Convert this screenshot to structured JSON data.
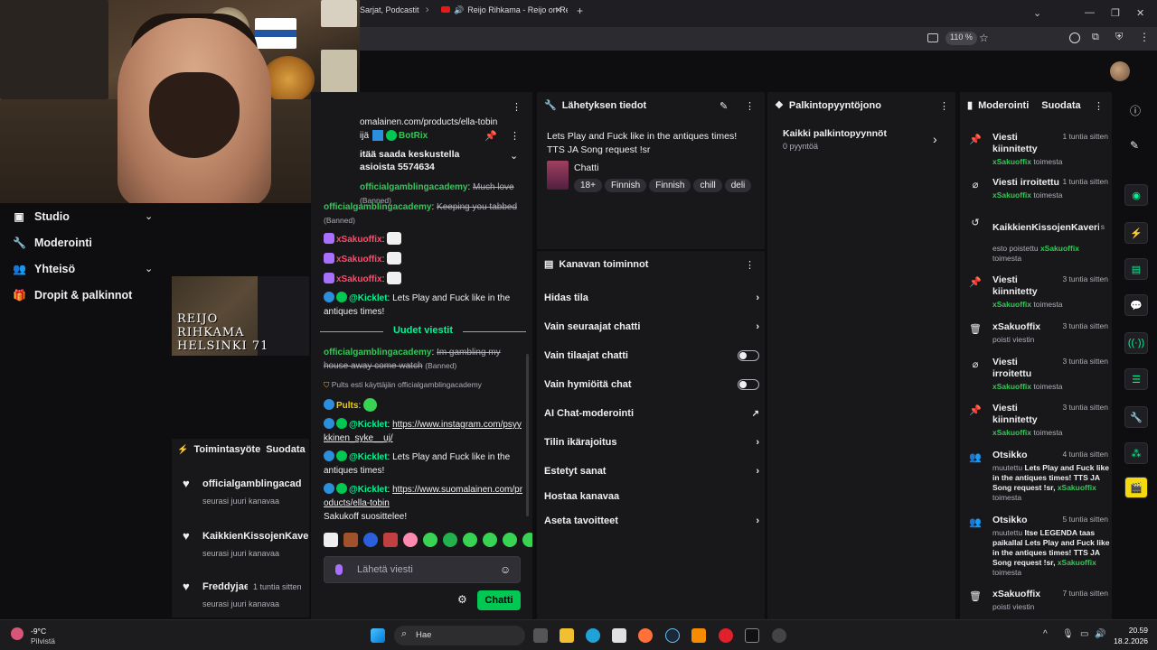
{
  "browser": {
    "tabs": [
      {
        "label": "Sarjat, Podcastit, Su"
      },
      {
        "label": "Reijo Rihkama - Reijo on Re"
      }
    ],
    "zoom": "110 %"
  },
  "nav": {
    "items": [
      {
        "label": "Studio",
        "icon": "camera-icon"
      },
      {
        "label": "Moderointi",
        "icon": "wrench-icon"
      },
      {
        "label": "Yhteisö",
        "icon": "people-icon"
      },
      {
        "label": "Dropit & palkinnot",
        "icon": "gift-icon"
      }
    ]
  },
  "preview": {
    "overlay_text": "REIJO RIHKAMA HELSINKI 71"
  },
  "activity": {
    "title": "Toimintasyöte",
    "filter": "Suodata",
    "items": [
      {
        "user": "officialgamblingacad",
        "time": "",
        "text": "seurasi juuri kanavaa"
      },
      {
        "user": "KaikkienKissojenKave",
        "time": "",
        "text": "seurasi juuri kanavaa"
      },
      {
        "user": "Freddyjael",
        "time": "1 tuntia sitten",
        "text": "seurasi juuri kanavaa"
      }
    ]
  },
  "chat": {
    "pinned_link": "omalainen.com/products/ella-tobin",
    "pinned_by_prefix": "ijä",
    "pinned_user": "BotRix",
    "pinned_text": "itää saada keskustella asioista 5574634",
    "messages": [
      {
        "user": "officialgamblingacademy",
        "text": "Much love",
        "status": "(Banned)"
      },
      {
        "user": "officialgamblingacademy",
        "text": "Keeping you tabbed",
        "status": "(Banned)"
      },
      {
        "user": "xSakuoffix",
        "text": ""
      },
      {
        "user": "xSakuoffix",
        "text": ""
      },
      {
        "user": "xSakuoffix",
        "text": ""
      },
      {
        "user": "@Kicklet",
        "text": "Lets Play and Fuck like in the antiques times!"
      }
    ],
    "new_messages_label": "Uudet viestit",
    "messages_after": [
      {
        "user": "officialgamblingacademy",
        "text": "Im gambling my house away come watch",
        "status": "(Banned)"
      },
      {
        "system": "Pults esti käyttäjän officialgamblingacademy"
      },
      {
        "user": "Pults",
        "text": ""
      },
      {
        "user": "@Kicklet",
        "text": "https://www.instagram.com/psyykkinen_syke__uj/"
      },
      {
        "user": "@Kicklet",
        "text": "Lets Play and Fuck like in the antiques times!"
      },
      {
        "user": "@Kicklet",
        "text": "https://www.suomalainen.com/products/ella-tobin",
        "extra": "Sakukoff suosittelee!"
      }
    ],
    "input_placeholder": "Lähetä viesti",
    "send_label": "Chatti"
  },
  "stream_info": {
    "title": "Lähetyksen tiedot",
    "stream_title": "Lets Play and Fuck like in the antiques times! TTS JA Song request !sr",
    "category": "Chatti",
    "tags": [
      "18+",
      "Finnish",
      "Finnish",
      "chill",
      "deli"
    ]
  },
  "channel_tools": {
    "title": "Kanavan toiminnot",
    "items": [
      {
        "label": "Hidas tila",
        "control": "chevron"
      },
      {
        "label": "Vain seuraajat chatti",
        "control": "chevron"
      },
      {
        "label": "Vain tilaajat chatti",
        "control": "toggle"
      },
      {
        "label": "Vain hymiöitä chat",
        "control": "toggle"
      },
      {
        "label": "AI Chat-moderointi",
        "control": "external"
      },
      {
        "label": "Tilin ikärajoitus",
        "control": "chevron"
      },
      {
        "label": "Estetyt sanat",
        "control": "chevron"
      },
      {
        "label": "Hostaa kanavaa",
        "control": "none"
      },
      {
        "label": "Aseta tavoitteet",
        "control": "chevron"
      }
    ]
  },
  "rewards": {
    "title": "Palkintopyyntöjono",
    "item_label": "Kaikki palkintopyynnöt",
    "item_count": "0 pyyntöä"
  },
  "modlog": {
    "title": "Moderointi",
    "filter": "Suodata",
    "entries": [
      {
        "icon": "pin-icon",
        "action": "Viesti kiinnitetty",
        "time": "1 tuntia sitten",
        "mod": "xSakuoffix",
        "suffix": "toimesta"
      },
      {
        "icon": "unpin-icon",
        "action": "Viesti irroitettu",
        "time": "1 tuntia sitten",
        "mod": "xSakuoffix",
        "suffix": "toimesta"
      },
      {
        "icon": "undo-icon",
        "action": "KaikkienKissojenKaveri",
        "time": "s",
        "prefix": "esto poistettu",
        "mod": "xSakuoffix",
        "suffix": "toimesta"
      },
      {
        "icon": "pin-icon",
        "action": "Viesti kiinnitetty",
        "time": "3 tuntia sitten",
        "mod": "xSakuoffix",
        "suffix": "toimesta"
      },
      {
        "icon": "trash-icon",
        "action": "xSakuoffix",
        "time": "3 tuntia sitten",
        "plain": "poisti viestin"
      },
      {
        "icon": "unpin-icon",
        "action": "Viesti irroitettu",
        "time": "3 tuntia sitten",
        "mod": "xSakuoffix",
        "suffix": "toimesta"
      },
      {
        "icon": "pin-icon",
        "action": "Viesti kiinnitetty",
        "time": "3 tuntia sitten",
        "mod": "xSakuoffix",
        "suffix": "toimesta"
      },
      {
        "icon": "people-icon",
        "action": "Otsikko",
        "time": "4 tuntia sitten",
        "prefix": "muutettu",
        "detail": "Lets Play and Fuck like in the antiques times! TTS JA Song request !sr,",
        "mod": "xSakuoffix",
        "suffix": "toimesta"
      },
      {
        "icon": "people-icon",
        "action": "Otsikko",
        "time": "5 tuntia sitten",
        "prefix": "muutettu",
        "detail": "Itse LEGENDA taas paikallal Lets Play and Fuck like in the antiques times! TTS JA Song request !sr,",
        "mod": "xSakuoffix",
        "suffix": "toimesta"
      },
      {
        "icon": "trash-icon",
        "action": "xSakuoffix",
        "time": "7 tuntia sitten",
        "plain": "poisti viestin"
      }
    ]
  },
  "taskbar": {
    "weather_temp": "-9°C",
    "weather_desc": "Pilvistä",
    "search_placeholder": "Hae",
    "time": "20.59",
    "date": "18.2.2026"
  }
}
